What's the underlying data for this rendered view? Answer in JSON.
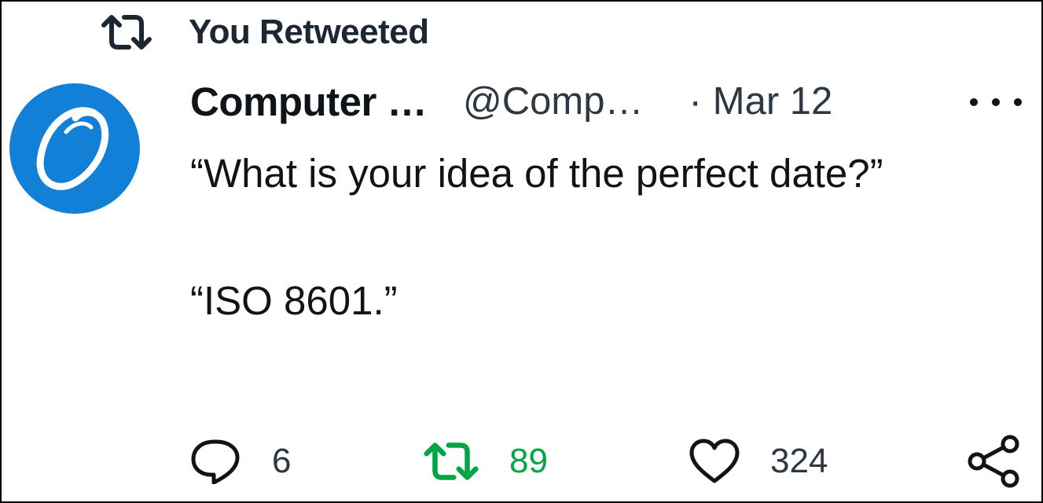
{
  "context": {
    "label": "You Retweeted",
    "icon": "retweet-icon"
  },
  "author": {
    "avatar_letter": "O",
    "name": "Computer …",
    "handle": "@Comp…",
    "separator": "·",
    "date": "Mar 12"
  },
  "tweet": {
    "line1": "“What is your idea of the perfect date?”",
    "line2": "“ISO 8601.”"
  },
  "actions": {
    "reply_count": "6",
    "retweet_count": "89",
    "like_count": "324"
  },
  "colors": {
    "text": "#0f1419",
    "secondary_text": "#2d3842",
    "avatar_blue": "#1280d6",
    "retweet_active": "#00a544"
  }
}
